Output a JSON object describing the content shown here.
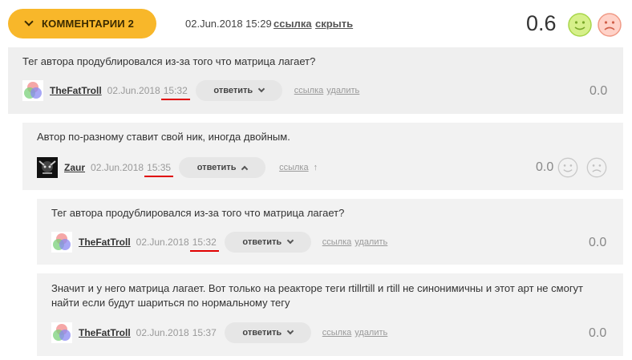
{
  "header": {
    "toggle_label": "КОММЕНТАРИИ 2",
    "date": "02.Jun.2018 15:29",
    "link_label": "ссылка",
    "hide_label": "скрыть",
    "score": "0.6"
  },
  "comments": [
    {
      "text": "Тег автора продублировался из-за того что матрица лагает?",
      "author": "TheFatTroll",
      "date": "02.Jun.2018",
      "time": "15:32",
      "reply_label": "ответить",
      "link_label": "ссылка",
      "delete_label": "удалить",
      "score": "0.0"
    },
    {
      "text": "Автор по-разному ставит свой ник, иногда двойным.",
      "author": "Zaur",
      "date": "02.Jun.2018",
      "time": "15:35",
      "reply_label": "ответить",
      "link_label": "ссылка",
      "up_arrow": "↑",
      "score": "0.0"
    },
    {
      "text": "Тег автора продублировался из-за того что матрица лагает?",
      "author": "TheFatTroll",
      "date": "02.Jun.2018",
      "time": "15:32",
      "reply_label": "ответить",
      "link_label": "ссылка",
      "delete_label": "удалить",
      "score": "0.0"
    },
    {
      "text": "Значит и у него матрица лагает. Вот только на реакторе теги rtillrtill и rtill не синонимичны и этот арт не смогут найти если будут шариться по нормальному тегу",
      "author": "TheFatTroll",
      "date": "02.Jun.2018",
      "time": "15:37",
      "reply_label": "ответить",
      "link_label": "ссылка",
      "delete_label": "удалить",
      "score": "0.0"
    }
  ],
  "colors": {
    "accent": "#f8b72a",
    "comment_bg_1": "#efefef",
    "comment_bg_2": "#f2f2f2",
    "underline_mark": "#e00000"
  }
}
